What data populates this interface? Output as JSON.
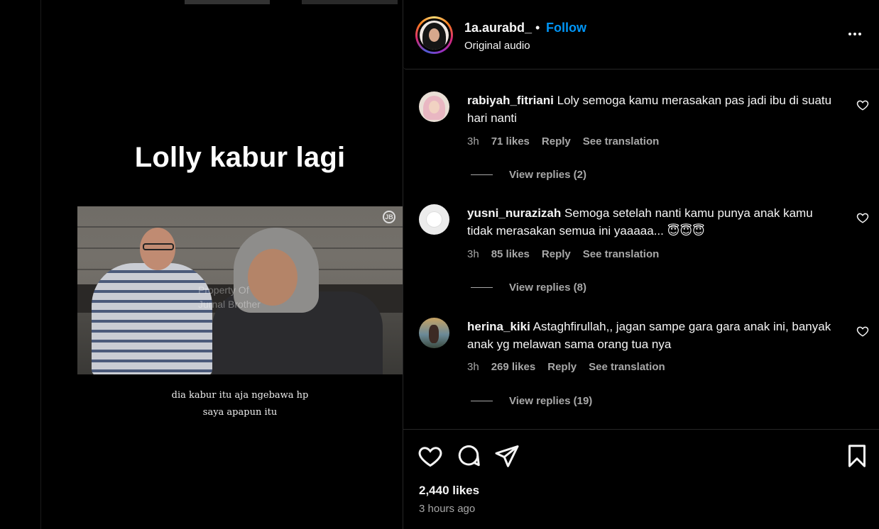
{
  "video": {
    "title": "Lolly kabur lagi",
    "subtitle_line1": "dia kabur itu aja ngebawa hp",
    "subtitle_line2": "saya apapun itu",
    "watermark_line1": "Property Of",
    "watermark_line2": "Jurnal Brother",
    "watermark_logo": "JB"
  },
  "post": {
    "username": "1a.aurabd_",
    "separator": "•",
    "follow_label": "Follow",
    "audio_label": "Original audio",
    "more_icon": "more-horizontal-icon",
    "follow_color": "#0095f6"
  },
  "comments": [
    {
      "username": "rabiyah_fitriani",
      "text": "Loly semoga kamu merasakan pas jadi ibu di suatu hari nanti",
      "time": "3h",
      "likes": "71 likes",
      "reply": "Reply",
      "translate": "See translation",
      "view_replies": "View replies (2)"
    },
    {
      "username": "yusni_nurazizah",
      "text": "Semoga setelah nanti kamu punya anak kamu tidak merasakan semua ini yaaaaa... 😇😇😇",
      "time": "3h",
      "likes": "85 likes",
      "reply": "Reply",
      "translate": "See translation",
      "view_replies": "View replies (8)"
    },
    {
      "username": "herina_kiki",
      "text": "Astaghfirullah,, jagan sampe gara gara anak ini, banyak anak yg melawan sama orang tua nya",
      "time": "3h",
      "likes": "269 likes",
      "reply": "Reply",
      "translate": "See translation",
      "view_replies": "View replies (19)"
    }
  ],
  "actions": {
    "like_icon": "heart-icon",
    "comment_icon": "comment-icon",
    "share_icon": "send-icon",
    "save_icon": "bookmark-icon",
    "likes_count": "2,440 likes",
    "posted_time": "3 hours ago"
  }
}
